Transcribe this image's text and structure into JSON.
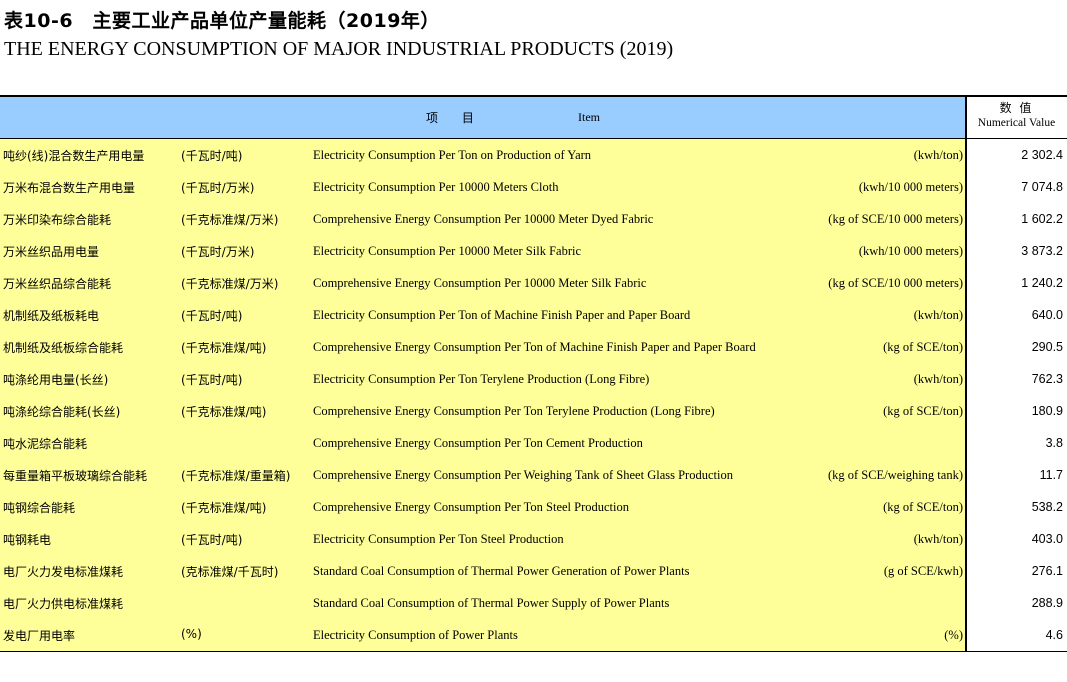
{
  "title": {
    "cn": "表10-6　主要工业产品单位产量能耗（2019年）",
    "en": "THE ENERGY CONSUMPTION OF MAJOR INDUSTRIAL PRODUCTS (2019)"
  },
  "header": {
    "item_cn": "项 目",
    "item_en": "Item",
    "value_cn": "数 值",
    "value_en": "Numerical Value"
  },
  "rows": [
    {
      "name_cn": "吨纱(线)混合数生产用电量",
      "unit_cn": "(千瓦时/吨)",
      "name_en": "Electricity Consumption Per Ton on Production of Yarn",
      "unit_en": "(kwh/ton)",
      "value": "2 302.4"
    },
    {
      "name_cn": "万米布混合数生产用电量",
      "unit_cn": "(千瓦时/万米)",
      "name_en": "Electricity Consumption Per 10000 Meters Cloth",
      "unit_en": "(kwh/10 000 meters)",
      "value": "7 074.8"
    },
    {
      "name_cn": "万米印染布综合能耗",
      "unit_cn": "(千克标准煤/万米)",
      "name_en": "Comprehensive Energy Consumption Per 10000 Meter Dyed Fabric",
      "unit_en": "(kg of SCE/10 000 meters)",
      "value": "1 602.2"
    },
    {
      "name_cn": "万米丝织品用电量",
      "unit_cn": "(千瓦时/万米)",
      "name_en": "Electricity Consumption Per 10000 Meter Silk Fabric",
      "unit_en": "(kwh/10 000 meters)",
      "value": "3 873.2"
    },
    {
      "name_cn": "万米丝织品综合能耗",
      "unit_cn": "(千克标准煤/万米)",
      "name_en": "Comprehensive Energy Consumption Per 10000 Meter Silk Fabric",
      "unit_en": "(kg of SCE/10 000 meters)",
      "value": "1 240.2"
    },
    {
      "name_cn": "机制纸及纸板耗电",
      "unit_cn": "(千瓦时/吨)",
      "name_en": "Electricity Consumption Per Ton of Machine Finish Paper and Paper Board",
      "unit_en": "(kwh/ton)",
      "value": "640.0"
    },
    {
      "name_cn": "机制纸及纸板综合能耗",
      "unit_cn": "(千克标准煤/吨)",
      "name_en": "Comprehensive Energy Consumption Per Ton of Machine Finish Paper and Paper Board",
      "unit_en": "(kg of SCE/ton)",
      "value": "290.5"
    },
    {
      "name_cn": "吨涤纶用电量(长丝)",
      "unit_cn": "(千瓦时/吨)",
      "name_en": "Electricity Consumption Per Ton Terylene Production (Long Fibre)",
      "unit_en": "(kwh/ton)",
      "value": "762.3"
    },
    {
      "name_cn": "吨涤纶综合能耗(长丝)",
      "unit_cn": "(千克标准煤/吨)",
      "name_en": "Comprehensive Energy Consumption Per Ton Terylene Production (Long Fibre)",
      "unit_en": "(kg of SCE/ton)",
      "value": "180.9"
    },
    {
      "name_cn": "吨水泥综合能耗",
      "unit_cn": "",
      "name_en": "Comprehensive Energy Consumption Per Ton Cement Production",
      "unit_en": "",
      "value": "3.8"
    },
    {
      "name_cn": "每重量箱平板玻璃综合能耗",
      "unit_cn": "(千克标准煤/重量箱)",
      "name_en": "Comprehensive Energy Consumption Per Weighing Tank of Sheet Glass Production",
      "unit_en": "(kg of SCE/weighing tank)",
      "value": "11.7"
    },
    {
      "name_cn": "吨钢综合能耗",
      "unit_cn": "(千克标准煤/吨)",
      "name_en": "Comprehensive Energy Consumption Per Ton Steel Production",
      "unit_en": "(kg of SCE/ton)",
      "value": "538.2"
    },
    {
      "name_cn": "吨钢耗电",
      "unit_cn": "(千瓦时/吨)",
      "name_en": "Electricity Consumption Per Ton Steel Production",
      "unit_en": "(kwh/ton)",
      "value": "403.0"
    },
    {
      "name_cn": "电厂火力发电标准煤耗",
      "unit_cn": "(克标准煤/千瓦时)",
      "name_en": "Standard Coal Consumption of  Thermal Power Generation of Power Plants",
      "unit_en": "(g of SCE/kwh)",
      "value": "276.1"
    },
    {
      "name_cn": "电厂火力供电标准煤耗",
      "unit_cn": "",
      "name_en": "Standard Coal Consumption of  Thermal Power Supply of Power Plants",
      "unit_en": "",
      "value": "288.9"
    },
    {
      "name_cn": "发电厂用电率",
      "unit_cn": "(%)",
      "name_en": "Electricity Consumption of Power Plants",
      "unit_en": "(%)",
      "value": "4.6"
    }
  ]
}
